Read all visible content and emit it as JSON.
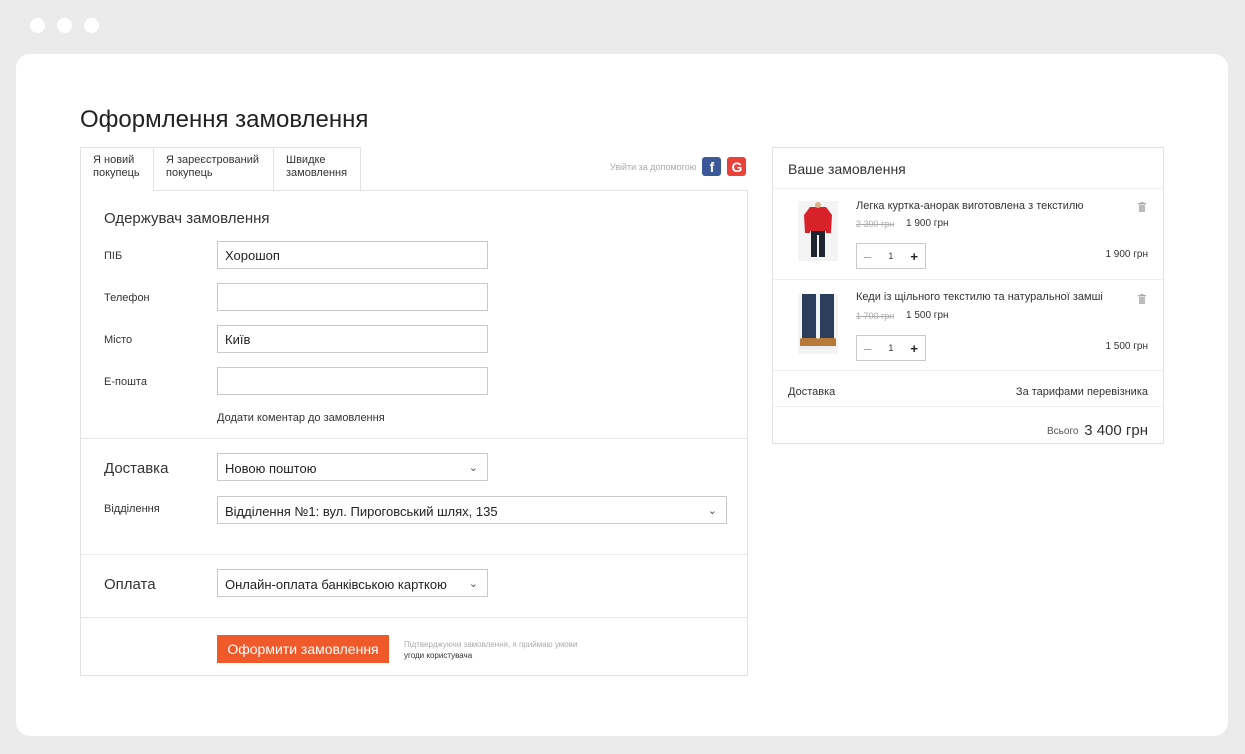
{
  "page_title": "Оформлення замовлення",
  "tabs": [
    {
      "label": "Я новий покупець"
    },
    {
      "label": "Я зареєстрований покупець"
    },
    {
      "label": "Швидке замовлення"
    }
  ],
  "social": {
    "label": "Увійти за допомогою",
    "facebook_icon": "f",
    "google_icon": "G"
  },
  "recipient": {
    "title": "Одержувач замовлення",
    "fields": [
      {
        "label": "ПІБ",
        "value": ""
      },
      {
        "label": "Телефон",
        "value": ""
      },
      {
        "label": "Місто",
        "value": "Київ"
      },
      {
        "label": "Е-пошта",
        "value": ""
      }
    ],
    "name_value": "Хорошоп",
    "comment_link": "Додати коментар до замовлення"
  },
  "delivery": {
    "title": "Доставка",
    "method": "Новою поштою",
    "branch_label": "Відділення",
    "branch": "Відділення №1: вул. Пироговський шлях, 135"
  },
  "payment": {
    "title": "Оплата",
    "method": "Онлайн-оплата банківською карткою"
  },
  "submit_label": "Оформити замовлення",
  "terms": {
    "text": "Підтверджуючи замовлення, я приймаю умови",
    "link": "угоди користувача"
  },
  "order": {
    "title": "Ваше замовлення",
    "items": [
      {
        "name": "Легка куртка-анорак виготовлена з текстилю",
        "old_price": "2 300 грн",
        "price": "1 900 грн",
        "qty": "1",
        "total": "1 900 грн"
      },
      {
        "name": "Кеди із щільного текстилю та натуральної замші",
        "old_price": "1 700 грн",
        "price": "1 500 грн",
        "qty": "1",
        "total": "1 500 грн"
      }
    ],
    "shipping_label": "Доставка",
    "shipping_value": "За тарифами перевізника",
    "total_label": "Всього",
    "total_value": "3 400 грн"
  },
  "colors": {
    "accent": "#f0592a",
    "facebook": "#3b5998",
    "google": "#e9423b"
  }
}
